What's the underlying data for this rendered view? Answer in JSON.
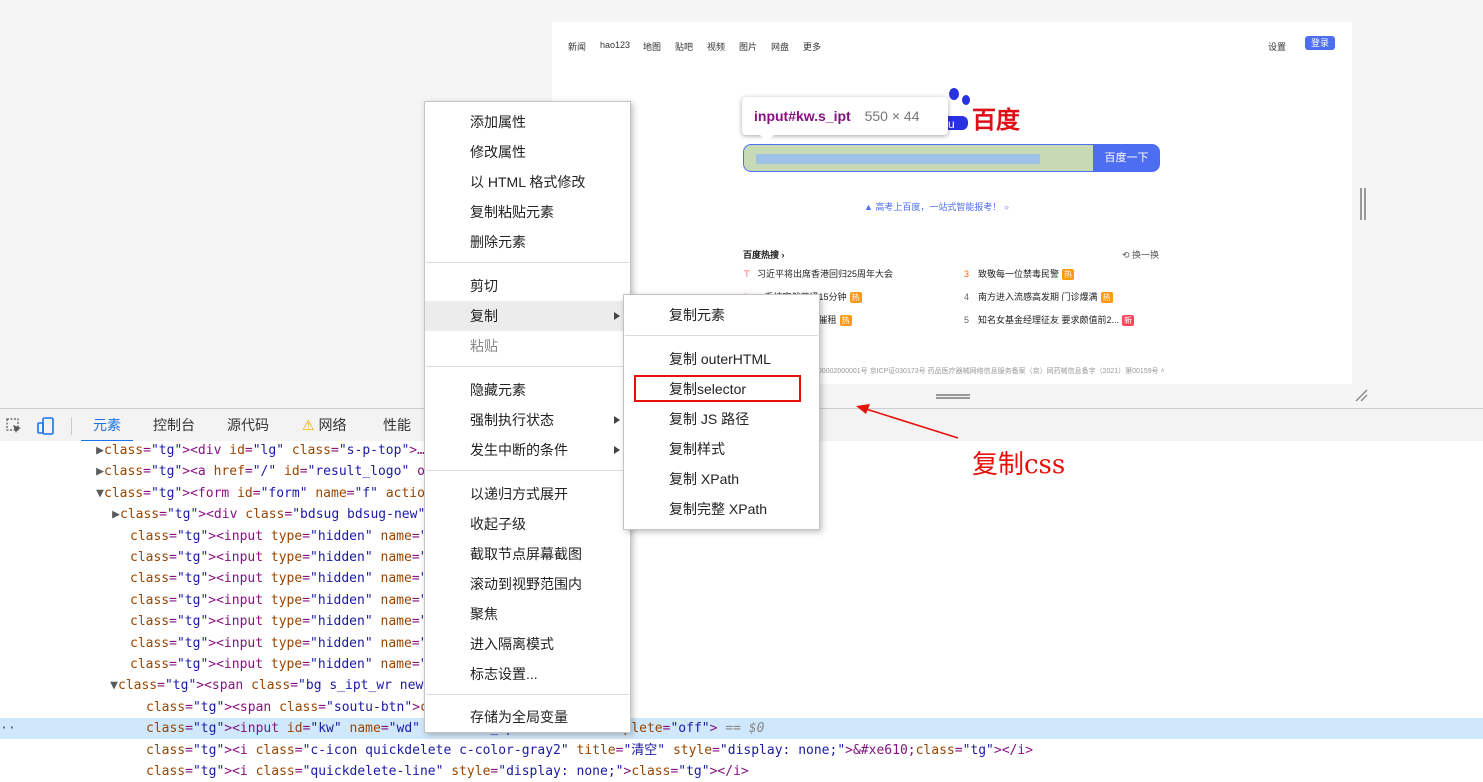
{
  "page_preview": {
    "nav_links": [
      "新闻",
      "hao123",
      "地图",
      "贴吧",
      "视频",
      "图片",
      "网盘",
      "更多"
    ],
    "settings": "设置",
    "login": "登录",
    "logo_text": "百度",
    "search_button": "百度一下",
    "promo": "高考上百度，一站式智能报考！",
    "hot_title": "百度热搜",
    "refresh": "换一换",
    "hot_items": [
      {
        "rank": "",
        "text": "习近平将出席香港回归25周年大会",
        "tag": ""
      },
      {
        "rank": "3",
        "text": "致敬每一位禁毒民警",
        "tag": "热"
      },
      {
        "rank": "1",
        "text": "...系统突然开通15分钟",
        "tag": "热"
      },
      {
        "rank": "4",
        "text": "南方进入流感高发期 门诊爆满",
        "tag": "热"
      },
      {
        "rank": "2",
        "text": "...遭中介掀被子催租",
        "tag": "热"
      },
      {
        "rank": "5",
        "text": "知名女基金经理征友 要求颇值前2...",
        "tag": "新"
      }
    ],
    "footer": "...00002000001号  京ICP证030173号  药品医疗器械网络信息服务备案（京）网药械信息备字（2021）第00159号"
  },
  "tooltip": {
    "selector": "input#kw.s_ipt",
    "size": "550 × 44"
  },
  "devtools": {
    "tabs": [
      "元素",
      "控制台",
      "源代码",
      "网络",
      "性能"
    ],
    "dom_lines": [
      {
        "indent": 104,
        "tw": "▶",
        "html": "<div id=\"lg\" class=\"s-p-top\">…</div>"
      },
      {
        "indent": 104,
        "tw": "▶",
        "html": "<a href=\"/\" id=\"result_logo\" onmousedc"
      },
      {
        "indent": 104,
        "tw": "▼",
        "html": "<form id=\"form\" name=\"f\" action=\"/s\" c"
      },
      {
        "indent": 120,
        "tw": "▶",
        "html": "<div class=\"bdsug bdsug-new\" style=\""
      },
      {
        "indent": 130,
        "tw": "",
        "html": "<input type=\"hidden\" name=\"ie\" value"
      },
      {
        "indent": 130,
        "tw": "",
        "html": "<input type=\"hidden\" name=\"f\" value="
      },
      {
        "indent": 130,
        "tw": "",
        "html": "<input type=\"hidden\" name=\"rsv_bp\" v"
      },
      {
        "indent": 130,
        "tw": "",
        "html": "<input type=\"hidden\" name=\"rsv_idx\""
      },
      {
        "indent": 130,
        "tw": "",
        "html": "<input type=\"hidden\" name=\"ch\" value"
      },
      {
        "indent": 130,
        "tw": "",
        "html": "<input type=\"hidden\" name=\"tn\" value"
      },
      {
        "indent": 130,
        "tw": "",
        "html": "<input type=\"hidden\" name=\"bar\" valu"
      },
      {
        "indent": 118,
        "tw": "▼",
        "html": "<span class=\"bg s_ipt_wr new-pmd qui"
      },
      {
        "indent": 146,
        "tw": "",
        "html": "<span class=\"soutu-btn\"></span>"
      },
      {
        "indent": 146,
        "tw": "",
        "html": "<input id=\"kw\" name=\"wd\" class=\"s_ipt\" ... autocomplete=\"off\"> == $0",
        "selected": true
      },
      {
        "indent": 146,
        "tw": "",
        "html": "<i class=\"c-icon quickdelete c-color-gray2\" title=\"清空\" style=\"display: none;\">&#xe610;</i>"
      },
      {
        "indent": 146,
        "tw": "",
        "html": "<i class=\"quickdelete-line\" style=\"display: none;\"></i>"
      }
    ]
  },
  "context_menu": {
    "items": [
      "添加属性",
      "修改属性",
      "以 HTML 格式修改",
      "复制粘贴元素",
      "删除元素",
      "剪切",
      "复制",
      "粘贴",
      "隐藏元素",
      "强制执行状态",
      "发生中断的条件",
      "以递归方式展开",
      "收起子级",
      "截取节点屏幕截图",
      "滚动到视野范围内",
      "聚焦",
      "进入隔离模式",
      "标志设置...",
      "存储为全局变量"
    ]
  },
  "copy_submenu": {
    "items": [
      "复制元素",
      "复制 outerHTML",
      "复制selector",
      "复制 JS 路径",
      "复制样式",
      "复制 XPath",
      "复制完整 XPath"
    ]
  },
  "annotation": {
    "text": "复制css",
    "color": "#e8100b"
  },
  "colors": {
    "accent": "#1a73e8",
    "baidu_blue": "#4e6ef2",
    "baidu_red": "#de0f17",
    "selected_row": "#cfe8fc"
  }
}
